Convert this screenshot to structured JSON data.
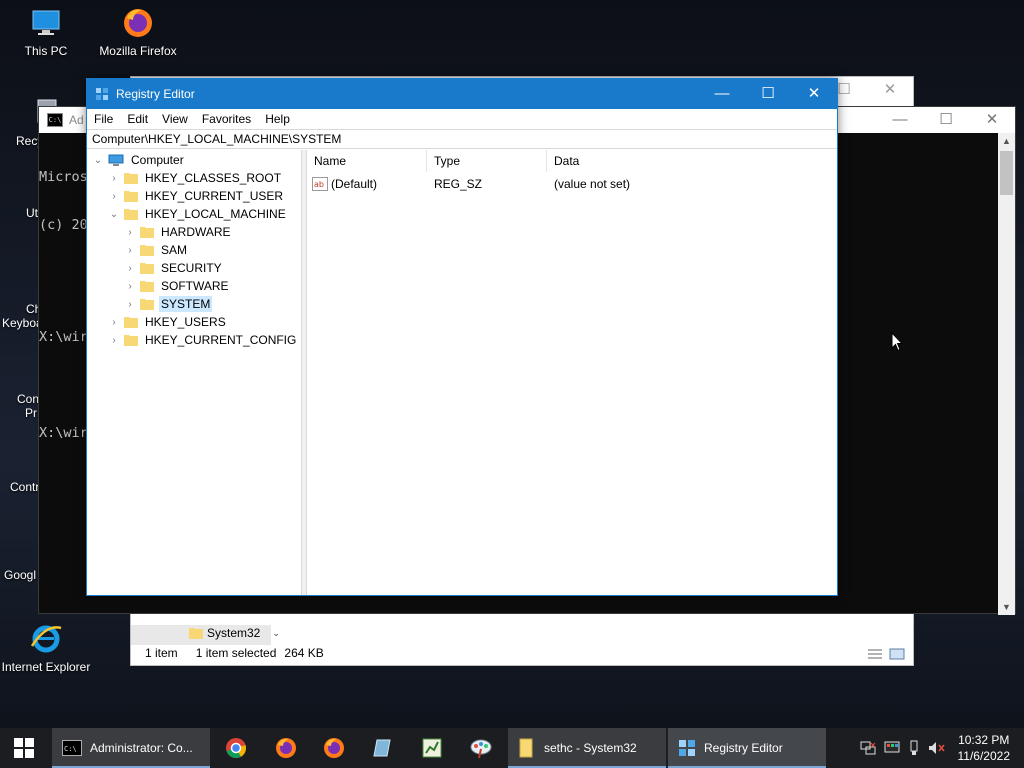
{
  "desktop": {
    "icons": [
      {
        "label": "This PC"
      },
      {
        "label": "Mozilla Firefox"
      },
      {
        "label": "Recy"
      },
      {
        "label": "Ut"
      },
      {
        "label": "Ch"
      },
      {
        "label": "Keyboa"
      },
      {
        "label": "Con"
      },
      {
        "label": "Pr"
      },
      {
        "label": "Contr"
      },
      {
        "label": "Googl"
      },
      {
        "label": "Internet Explorer"
      }
    ]
  },
  "cmd": {
    "title": "Ad",
    "lines": [
      "Micros",
      "(c) 20",
      "",
      "X:\\wir",
      "",
      "X:\\wir"
    ]
  },
  "explorer": {
    "nav_item": "System32",
    "status": {
      "count": "1 item",
      "selected": "1 item selected",
      "size": "264 KB"
    }
  },
  "regedit": {
    "title": "Registry Editor",
    "menu": [
      "File",
      "Edit",
      "View",
      "Favorites",
      "Help"
    ],
    "address": "Computer\\HKEY_LOCAL_MACHINE\\SYSTEM",
    "tree": {
      "root": "Computer",
      "hives": [
        "HKEY_CLASSES_ROOT",
        "HKEY_CURRENT_USER",
        "HKEY_LOCAL_MACHINE",
        "HKEY_USERS",
        "HKEY_CURRENT_CONFIG"
      ],
      "hklm_children": [
        "HARDWARE",
        "SAM",
        "SECURITY",
        "SOFTWARE",
        "SYSTEM"
      ],
      "selected": "SYSTEM"
    },
    "columns": {
      "name": "Name",
      "type": "Type",
      "data": "Data"
    },
    "values": [
      {
        "name": "(Default)",
        "type": "REG_SZ",
        "data": "(value not set)"
      }
    ]
  },
  "taskbar": {
    "items": [
      {
        "label": "Administrator: Co..."
      },
      {
        "label": "sethc - System32"
      },
      {
        "label": "Registry Editor"
      }
    ],
    "time": "10:32 PM",
    "date": "11/6/2022"
  },
  "colors": {
    "title_active": "#1979ca",
    "selection": "#cce8ff",
    "taskbar": "#1c1d20"
  }
}
